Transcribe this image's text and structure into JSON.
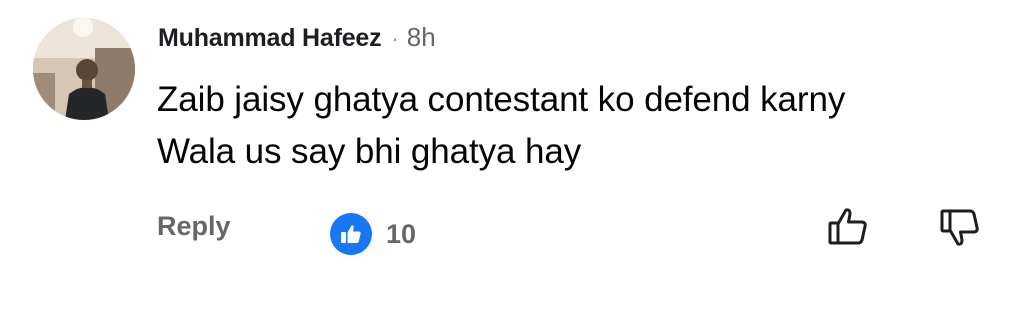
{
  "comment": {
    "author": "Muhammad Hafeez",
    "separator": "·",
    "timestamp": "8h",
    "text_lines": [
      "Zaib jaisy ghatya contestant ko defend karny",
      "Wala us say bhi ghatya hay"
    ],
    "avatar_icon": "user-avatar-photo"
  },
  "actions": {
    "reply_label": "Reply",
    "reaction_icon": "like-reaction-icon",
    "reaction_count": "10",
    "upvote_icon": "thumbs-up-icon",
    "downvote_icon": "thumbs-down-icon"
  },
  "colors": {
    "like_blue": "#1877f2",
    "secondary_text": "#65676b",
    "primary_text": "#050505"
  }
}
